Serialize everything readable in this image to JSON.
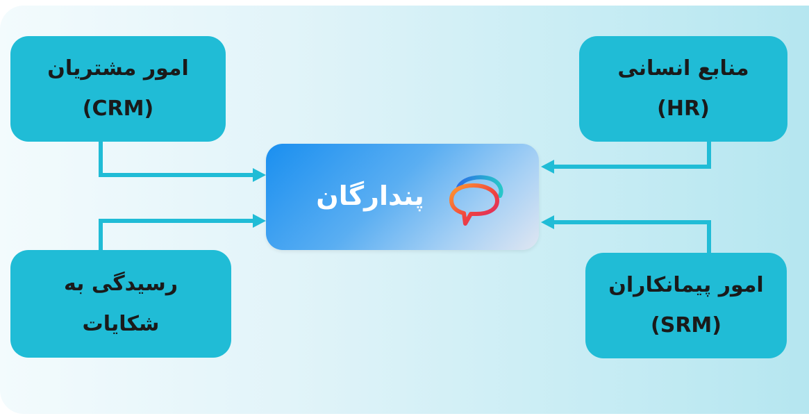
{
  "hub": {
    "label": "پندارگان",
    "logo_icon": "speech-bubble-logo-icon"
  },
  "nodes": {
    "crm": {
      "line1": "امور مشتریان",
      "line2": "(CRM)"
    },
    "hr": {
      "line1": "منابع انسانی",
      "line2": "(HR)"
    },
    "complaints": {
      "line1": "رسیدگی به",
      "line2": "شکایات"
    },
    "srm": {
      "line1": "امور پیمانکاران",
      "line2": "(SRM)"
    }
  },
  "colors": {
    "node_fill": "#20bcd6",
    "connector": "#20bcd6",
    "hub_gradient_start": "#1a8ff0",
    "hub_gradient_end": "#dfe6f2",
    "background_start": "#f3fbfd",
    "background_end": "#b5e6f0"
  }
}
